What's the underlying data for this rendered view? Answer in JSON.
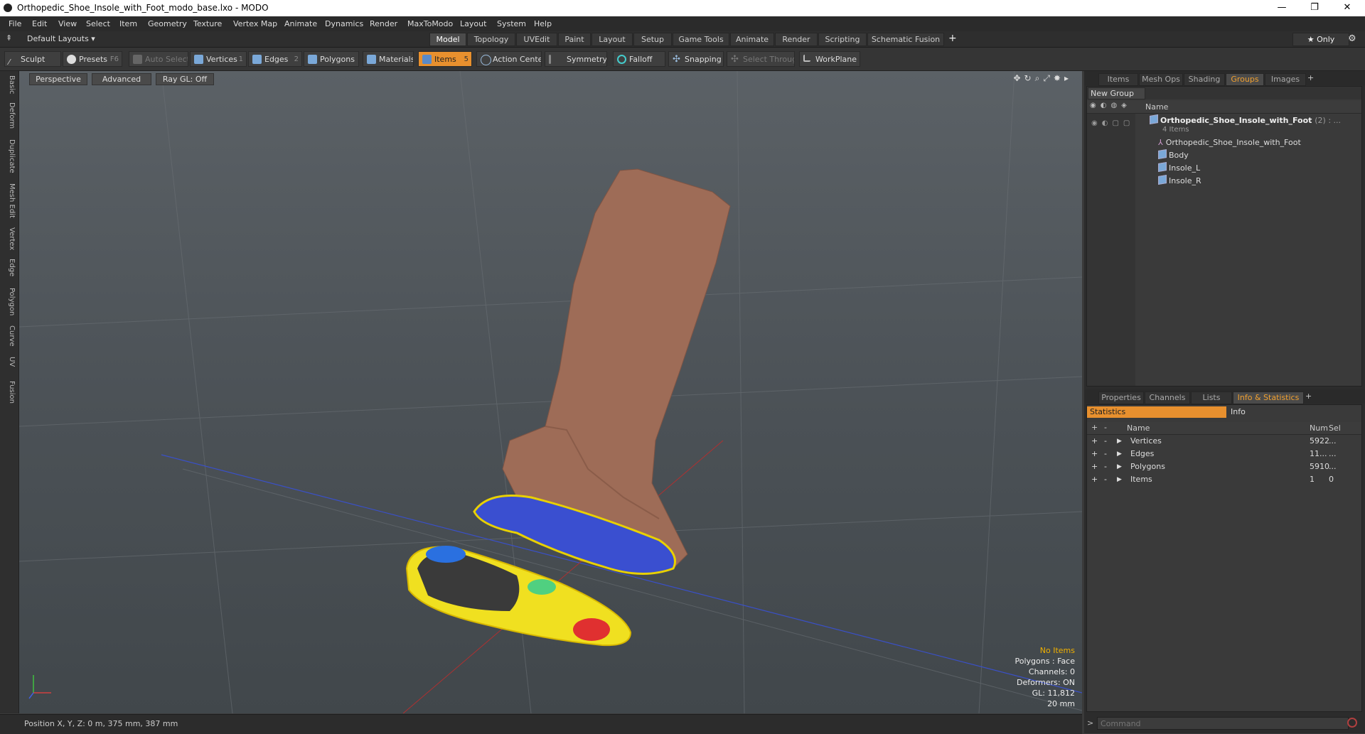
{
  "window": {
    "title": "Orthopedic_Shoe_Insole_with_Foot_modo_base.lxo - MODO",
    "min": "—",
    "max": "❐",
    "close": "✕"
  },
  "menu": [
    "File",
    "Edit",
    "View",
    "Select",
    "Item",
    "Geometry",
    "Texture",
    "Vertex Map",
    "Animate",
    "Dynamics",
    "Render",
    "MaxToModo",
    "Layout",
    "System",
    "Help"
  ],
  "layout_selector": "Default Layouts ▾",
  "layout_tabs": [
    "Model",
    "Topology",
    "UVEdit",
    "Paint",
    "Layout",
    "Setup",
    "Game Tools",
    "Animate",
    "Render",
    "Scripting",
    "Schematic Fusion"
  ],
  "layout_add": "+",
  "only_label": "★  Only",
  "settings_glyph": "⚙",
  "toolbar": {
    "sculpt": "Sculpt",
    "presets": "Presets",
    "presets_key": "F6",
    "auto_select": "Auto Select",
    "vertices": "Vertices",
    "vertices_key": "1",
    "edges": "Edges",
    "edges_key": "2",
    "polygons": "Polygons",
    "materials": "Materials",
    "items": "Items",
    "items_key": "5",
    "action_center": "Action Center",
    "symmetry": "Symmetry",
    "falloff": "Falloff",
    "snapping": "Snapping",
    "select_through": "Select Through",
    "workplane": "WorkPlane"
  },
  "left_tabs": [
    "Basic",
    "Deform",
    "Duplicate",
    "Mesh Edit",
    "Vertex",
    "Edge",
    "Polygon",
    "Curve",
    "UV",
    "Fusion"
  ],
  "viewport": {
    "view": "Perspective",
    "shading": "Advanced",
    "raygl": "Ray GL: Off",
    "info": {
      "no_items": "No Items",
      "polygons": "Polygons : Face",
      "channels": "Channels: 0",
      "deformers": "Deformers: ON",
      "gl": "GL: 11,812",
      "scale": "20 mm"
    }
  },
  "status": {
    "position": "Position X, Y, Z:   0 m, 375 mm, 387 mm"
  },
  "top_panel": {
    "tabs": [
      "Items",
      "Mesh Ops",
      "Shading",
      "Groups",
      "Images"
    ],
    "active": "Groups",
    "add": "+",
    "new_group": "New Group",
    "name_header": "Name",
    "group_name": "Orthopedic_Shoe_Insole_with_Foot",
    "group_count": "(2) : ...",
    "group_items": "4 Items",
    "children": [
      "Orthopedic_Shoe_Insole_with_Foot",
      "Body",
      "Insole_L",
      "Insole_R"
    ]
  },
  "bottom_panel": {
    "tabs": [
      "Properties",
      "Channels",
      "Lists",
      "Info & Statistics"
    ],
    "active": "Info & Statistics",
    "add": "+",
    "subtabs": [
      "Statistics",
      "Info"
    ],
    "headers": {
      "name": "Name",
      "num": "Num",
      "sel": "Sel"
    },
    "rows": [
      {
        "name": "Vertices",
        "num": "5922",
        "sel": "..."
      },
      {
        "name": "Edges",
        "num": "11...",
        "sel": "..."
      },
      {
        "name": "Polygons",
        "num": "5910",
        "sel": "..."
      },
      {
        "name": "Items",
        "num": "1",
        "sel": "0"
      }
    ],
    "command_placeholder": "Command"
  },
  "colors": {
    "accent": "#e8902e",
    "active_tab_text": "#f0a030",
    "info_warn": "#f0b000"
  }
}
